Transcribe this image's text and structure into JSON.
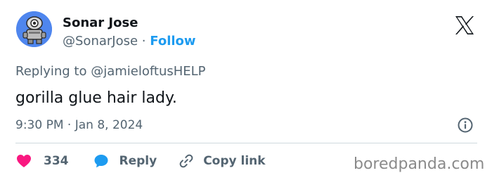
{
  "author": {
    "name": "Sonar Jose",
    "handle": "@SonarJose",
    "separator": "·",
    "follow_label": "Follow"
  },
  "reply_context": {
    "prefix": "Replying to",
    "mention": "@jamieloftusHELP"
  },
  "tweet": {
    "text": "gorilla glue hair lady.",
    "timestamp": "9:30 PM · Jan 8, 2024"
  },
  "actions": {
    "like_count": "334",
    "reply_label": "Reply",
    "copy_link_label": "Copy link"
  },
  "icons": {
    "logo": "x-logo-icon",
    "info": "info-icon",
    "like": "heart-icon",
    "reply": "speech-bubble-icon",
    "copy": "link-icon"
  },
  "colors": {
    "like": "#f91880",
    "reply_icon": "#1d9bf0",
    "follow": "#1d9bf0",
    "secondary_text": "#536471"
  },
  "watermark": "boredpanda.com"
}
